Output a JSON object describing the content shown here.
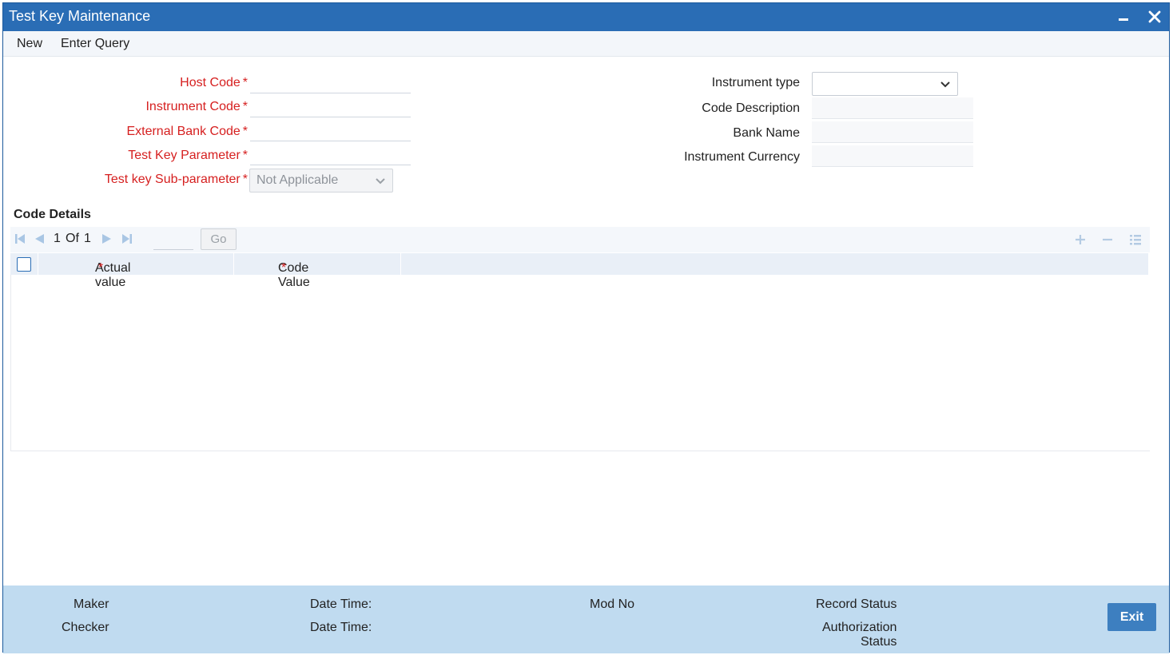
{
  "window": {
    "title": "Test Key Maintenance"
  },
  "menu": {
    "new": "New",
    "enter_query": "Enter Query"
  },
  "form_left": {
    "host_code": {
      "label": "Host Code",
      "value": ""
    },
    "instrument_code": {
      "label": "Instrument Code",
      "value": ""
    },
    "external_bank_code": {
      "label": "External Bank Code",
      "value": ""
    },
    "test_key_parameter": {
      "label": "Test Key Parameter",
      "value": ""
    },
    "test_key_sub_parameter": {
      "label": "Test key Sub-parameter",
      "value": "Not Applicable"
    }
  },
  "required_marker": "*",
  "form_right": {
    "instrument_type": {
      "label": "Instrument type",
      "value": ""
    },
    "code_description": {
      "label": "Code Description",
      "value": ""
    },
    "bank_name": {
      "label": "Bank Name",
      "value": ""
    },
    "instrument_currency": {
      "label": "Instrument Currency",
      "value": ""
    }
  },
  "code_details": {
    "title": "Code Details",
    "pager": {
      "current": "1",
      "of_label": "Of",
      "total": "1",
      "go_label": "Go"
    },
    "columns": [
      {
        "label": "Actual value"
      },
      {
        "label": "Code Value"
      }
    ],
    "rows": []
  },
  "footer": {
    "maker": "Maker",
    "checker": "Checker",
    "date_time_1": "Date Time:",
    "date_time_2": "Date Time:",
    "mod_no": "Mod No",
    "record_status": "Record Status",
    "authorization_status_1": "Authorization",
    "authorization_status_2": "Status",
    "exit": "Exit"
  },
  "colors": {
    "title_bar": "#2a6db5",
    "required": "#d62020",
    "footer_bg": "#c0dbf0",
    "exit_button": "#3d7fc0"
  }
}
